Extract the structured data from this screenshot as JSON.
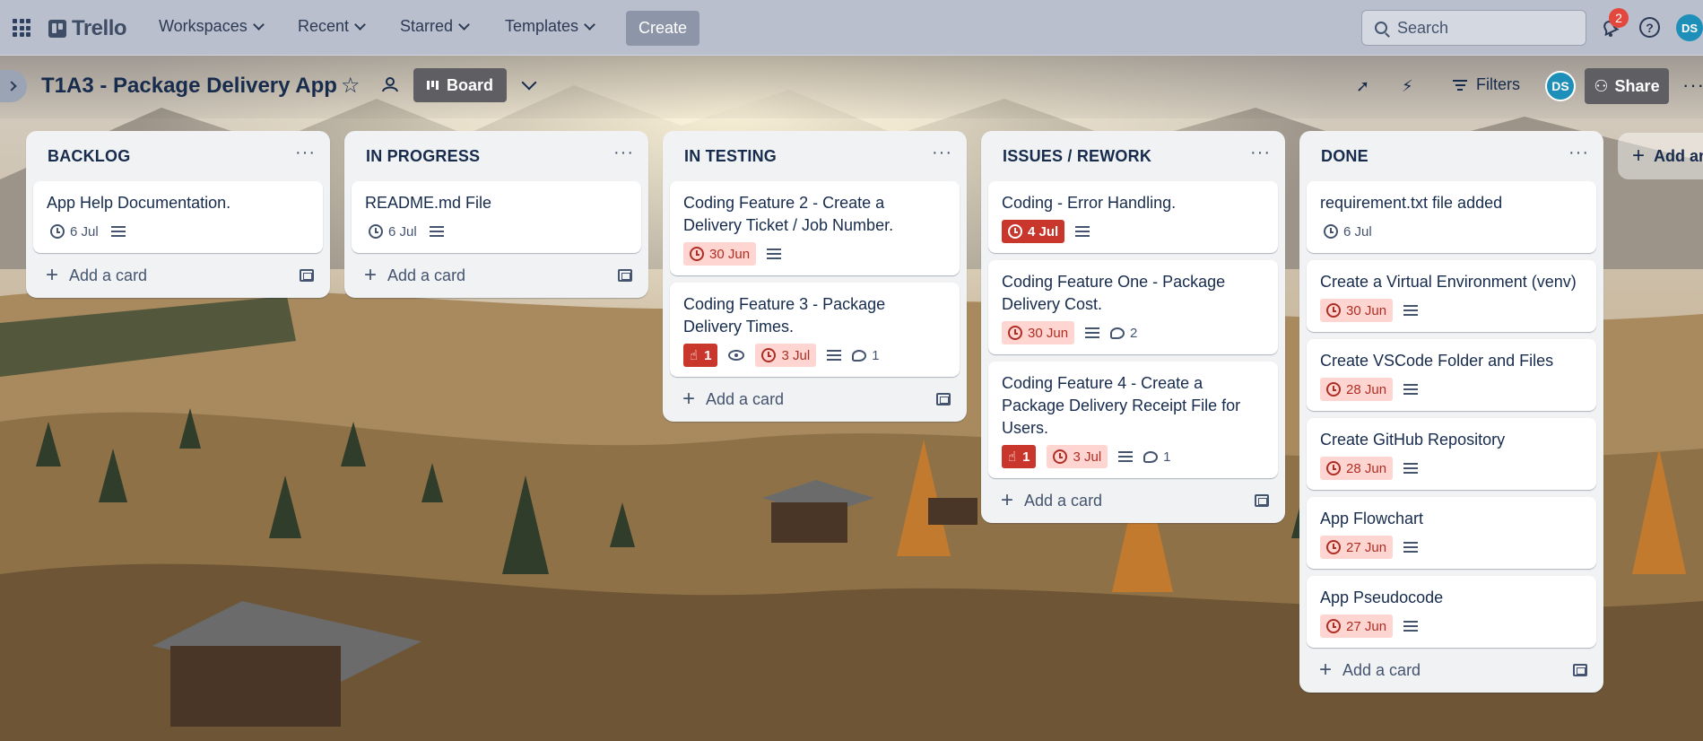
{
  "topbar": {
    "logo": "Trello",
    "nav": [
      "Workspaces",
      "Recent",
      "Starred",
      "Templates"
    ],
    "create_label": "Create",
    "search_placeholder": "Search",
    "notification_count": "2",
    "help_label": "?",
    "avatar_initials": "DS"
  },
  "board": {
    "title": "T1A3 - Package Delivery App",
    "view_label": "Board",
    "filters_label": "Filters",
    "member_initials": "DS",
    "share_label": "Share",
    "add_list_label": "Add another list"
  },
  "add_card_label": "Add a card",
  "lists": [
    {
      "title": "BACKLOG",
      "cards": [
        {
          "title": "App Help Documentation.",
          "date": "6 Jul"
        }
      ]
    },
    {
      "title": "IN PROGRESS",
      "cards": [
        {
          "title": "README.md File",
          "date": "6 Jul"
        }
      ]
    },
    {
      "title": "IN TESTING",
      "cards": [
        {
          "title": "Coding Feature 2 - Create a Delivery Ticket / Job Number.",
          "date": "30 Jun"
        },
        {
          "title": "Coding Feature 3 - Package Delivery Times.",
          "votes": "1",
          "date": "3 Jul",
          "comments": "1"
        }
      ]
    },
    {
      "title": "ISSUES / REWORK",
      "cards": [
        {
          "title": "Coding - Error Handling.",
          "date": "4 Jul"
        },
        {
          "title": "Coding Feature One - Package Delivery Cost.",
          "date": "30 Jun",
          "comments": "2"
        },
        {
          "title": "Coding Feature 4 - Create a Package Delivery Receipt File for Users.",
          "votes": "1",
          "date": "3 Jul",
          "comments": "1"
        }
      ]
    },
    {
      "title": "DONE",
      "cards": [
        {
          "title": "requirement.txt file added",
          "date": "6 Jul"
        },
        {
          "title": "Create a Virtual Environment (venv)",
          "date": "30 Jun"
        },
        {
          "title": "Create VSCode Folder and Files",
          "date": "28 Jun"
        },
        {
          "title": "Create GitHub Repository",
          "date": "28 Jun"
        },
        {
          "title": "App Flowchart",
          "date": "27 Jun"
        },
        {
          "title": "App Pseudocode",
          "date": "27 Jun"
        }
      ]
    }
  ],
  "colors": {
    "topbar": "#b9bfcc",
    "overdue_soft_bg": "#ffd5d2",
    "overdue_hard_bg": "#c9372c",
    "accent_avatar": "#1d8fb8"
  }
}
